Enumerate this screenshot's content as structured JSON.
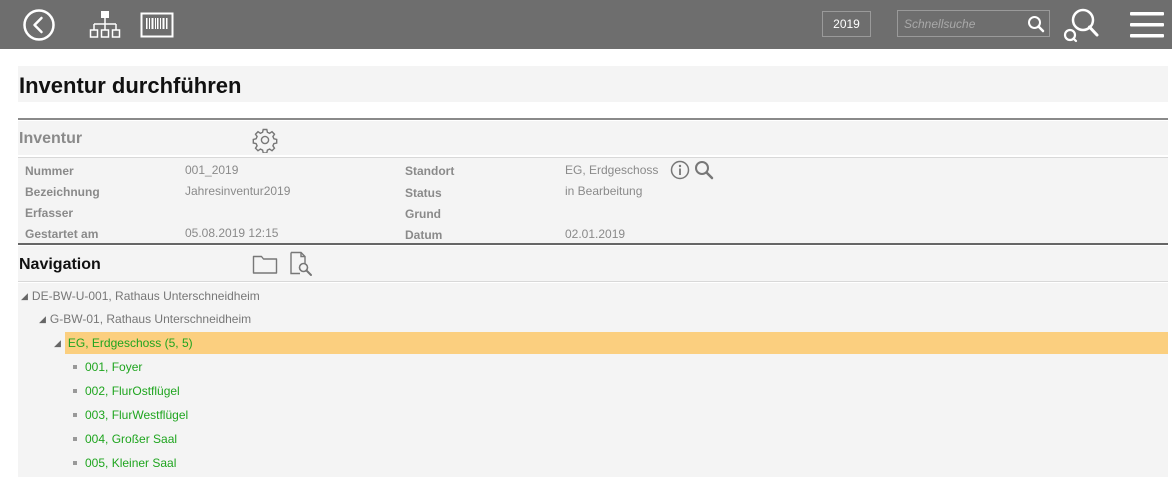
{
  "topbar": {
    "year": "2019",
    "search_placeholder": "Schnellsuche"
  },
  "page": {
    "title": "Inventur durchführen"
  },
  "inventur": {
    "section_title": "Inventur",
    "fields_left": [
      {
        "label": "Nummer",
        "value": "001_2019"
      },
      {
        "label": "Bezeichnung",
        "value": "Jahresinventur2019"
      },
      {
        "label": "Erfasser",
        "value": ""
      },
      {
        "label": "Gestartet am",
        "value": "05.08.2019 12:15"
      }
    ],
    "fields_right": [
      {
        "label": "Standort",
        "value": "EG, Erdgeschoss"
      },
      {
        "label": "Status",
        "value": "in Bearbeitung"
      },
      {
        "label": "Grund",
        "value": ""
      },
      {
        "label": "Datum",
        "value": "02.01.2019"
      }
    ]
  },
  "navigation": {
    "section_title": "Navigation",
    "tree": [
      {
        "label": "DE-BW-U-001, Rathaus Unterschneidheim",
        "level": 0
      },
      {
        "label": "G-BW-01, Rathaus Unterschneidheim",
        "level": 1
      },
      {
        "label": "EG, Erdgeschoss (5, 5)",
        "level": 2,
        "selected": true
      },
      {
        "label": "001, Foyer",
        "level": 3
      },
      {
        "label": "002, FlurOstflügel",
        "level": 3
      },
      {
        "label": "003, FlurWestflügel",
        "level": 3
      },
      {
        "label": "004, Großer Saal",
        "level": 3
      },
      {
        "label": "005, Kleiner Saal",
        "level": 3
      }
    ]
  },
  "colors": {
    "topbar": "#6e6e6e",
    "selected_row": "#fbcf7f",
    "tree_green": "#1fa51f"
  }
}
